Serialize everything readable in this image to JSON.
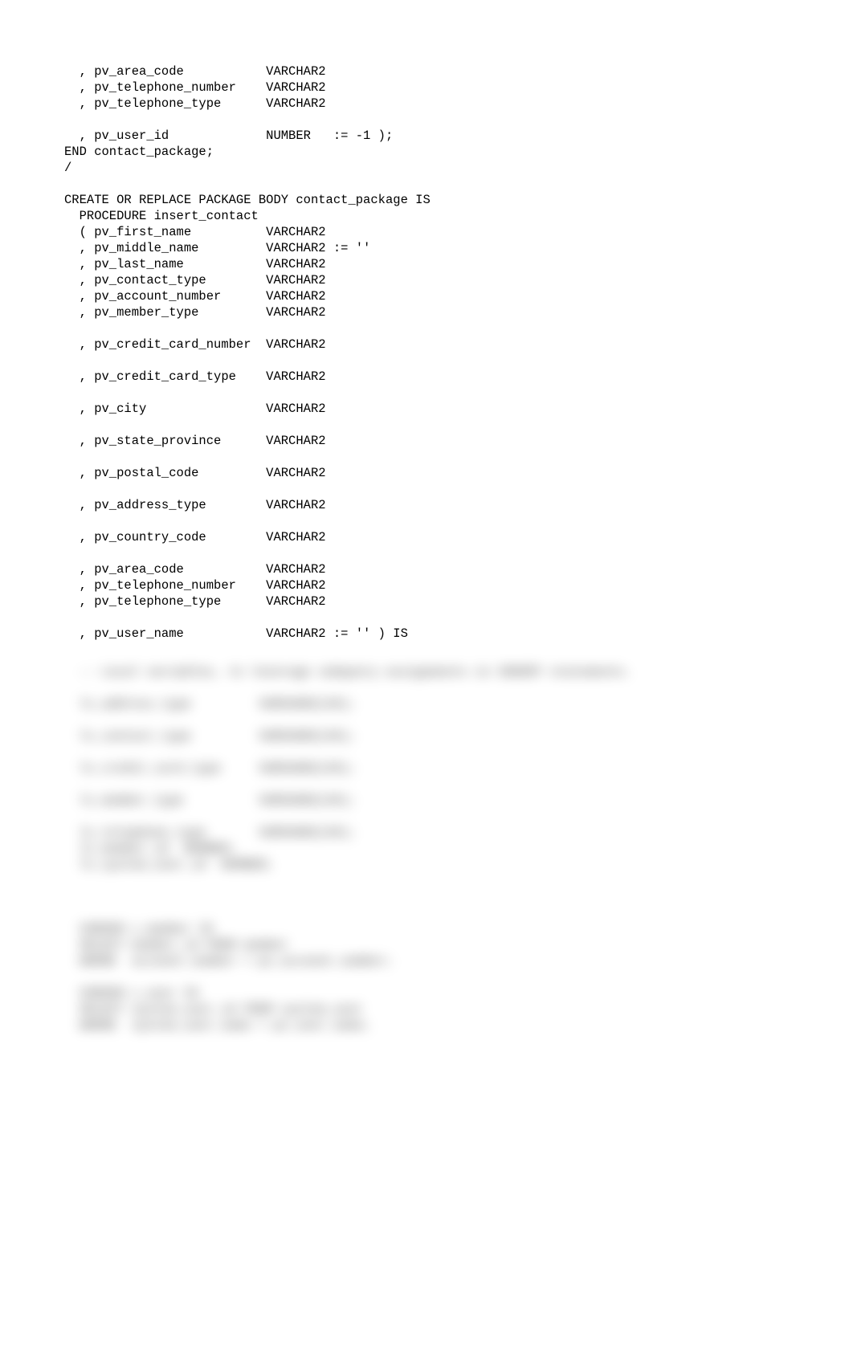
{
  "code": {
    "lines": [
      "  , pv_area_code           VARCHAR2",
      "  , pv_telephone_number    VARCHAR2",
      "  , pv_telephone_type      VARCHAR2",
      "",
      "  , pv_user_id             NUMBER   := -1 );",
      "END contact_package;",
      "/",
      "",
      "CREATE OR REPLACE PACKAGE BODY contact_package IS",
      "  PROCEDURE insert_contact",
      "  ( pv_first_name          VARCHAR2",
      "  , pv_middle_name         VARCHAR2 := ''",
      "  , pv_last_name           VARCHAR2",
      "  , pv_contact_type        VARCHAR2",
      "  , pv_account_number      VARCHAR2",
      "  , pv_member_type         VARCHAR2",
      "",
      "  , pv_credit_card_number  VARCHAR2",
      "",
      "  , pv_credit_card_type    VARCHAR2",
      "",
      "  , pv_city                VARCHAR2",
      "",
      "  , pv_state_province      VARCHAR2",
      "",
      "  , pv_postal_code         VARCHAR2",
      "",
      "  , pv_address_type        VARCHAR2",
      "",
      "  , pv_country_code        VARCHAR2",
      "",
      "  , pv_area_code           VARCHAR2",
      "  , pv_telephone_number    VARCHAR2",
      "  , pv_telephone_type      VARCHAR2",
      "",
      "  , pv_user_name           VARCHAR2 := '' ) IS",
      ""
    ]
  },
  "blurred": {
    "lines": [
      "  -- Local variables, to leverage subquery assignments in INSERT statements.",
      "",
      "  lv_address_type         VARCHAR2(30);",
      "",
      "  lv_contact_type         VARCHAR2(30);",
      "",
      "  lv_credit_card_type     VARCHAR2(30);",
      "",
      "  lv_member_type          VARCHAR2(30);",
      "",
      "  lv_telephone_type       VARCHAR2(30);",
      "  lv_member_id  NUMBER;",
      "  lv_system_user_id  NUMBER;",
      "",
      "",
      "",
      "  CURSOR c_member IS",
      "  SELECT member_id FROM member",
      "  WHERE  account_number = pv_account_number;",
      "",
      "  CURSOR c_user IS",
      "  SELECT system_user_id FROM system_user",
      "  WHERE  system_user_name = pv_user_name;"
    ]
  }
}
